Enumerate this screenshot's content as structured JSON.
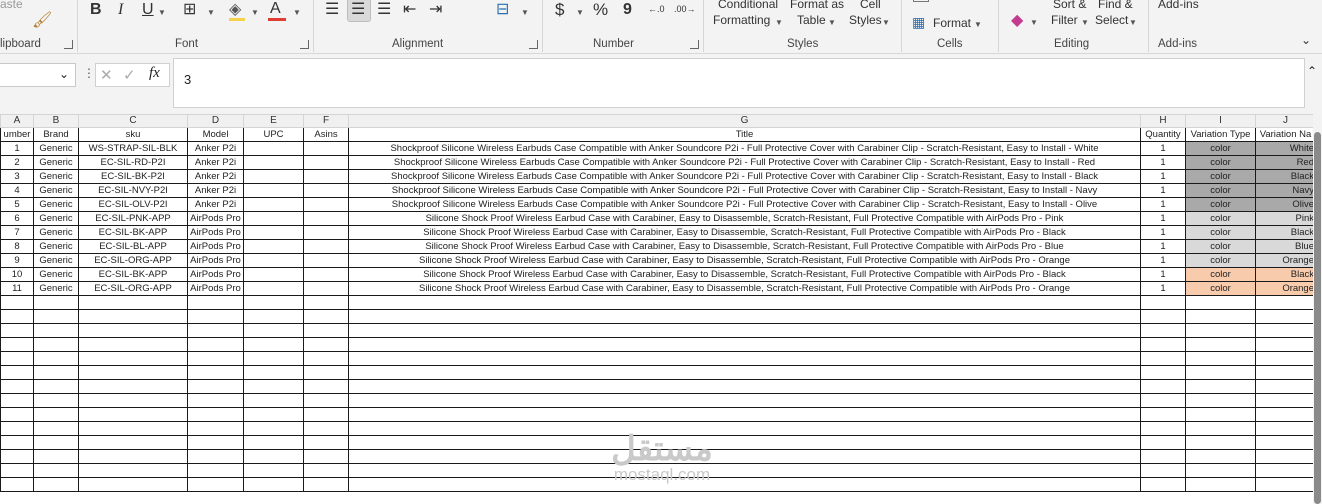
{
  "ribbon": {
    "clipboard": {
      "paste_label": "aste",
      "group_label": "lipboard"
    },
    "font": {
      "group_label": "Font",
      "bold_label": "B",
      "italic_label": "I",
      "underline_label": "U",
      "font_color_label": "A",
      "font_color": "#e03c31"
    },
    "alignment": {
      "group_label": "Alignment"
    },
    "number": {
      "group_label": "Number",
      "currency_label": "$",
      "percent_label": "%",
      "comma_label": "9"
    },
    "styles": {
      "group_label": "Styles",
      "conditional_line1": "Conditional",
      "conditional_line2": "Formatting",
      "format_table_line1": "Format as",
      "format_table_line2": "Table",
      "cell_styles_line1": "Cell",
      "cell_styles_line2": "Styles"
    },
    "cells": {
      "group_label": "Cells",
      "format_label": "Format"
    },
    "editing": {
      "group_label": "Editing",
      "sort_line1": "Sort &",
      "sort_line2": "Filter",
      "find_line1": "Find &",
      "find_line2": "Select"
    },
    "addins": {
      "group_label": "Add-ins",
      "button_label": "Add-ins"
    }
  },
  "formula_bar": {
    "fx_label": "fx",
    "value": "3"
  },
  "columns": [
    {
      "letter": "A",
      "header": "umber"
    },
    {
      "letter": "B",
      "header": "Brand"
    },
    {
      "letter": "C",
      "header": "sku"
    },
    {
      "letter": "D",
      "header": "Model"
    },
    {
      "letter": "E",
      "header": "UPC"
    },
    {
      "letter": "F",
      "header": "Asins"
    },
    {
      "letter": "G",
      "header": "Title"
    },
    {
      "letter": "H",
      "header": "Quantity"
    },
    {
      "letter": "I",
      "header": "Variation Type"
    },
    {
      "letter": "J",
      "header": "Variation Na"
    }
  ],
  "rows": [
    {
      "number": "1",
      "brand": "Generic",
      "sku": "WS-STRAP-SIL-BLK",
      "model": "Anker P2i",
      "upc": "",
      "asins": "",
      "title": "Shockproof Silicone Wireless Earbuds Case Compatible with Anker Soundcore P2i - Full Protective Cover with Carabiner Clip - Scratch-Resistant, Easy to Install - White",
      "quantity": "1",
      "variation_type": "color",
      "variation_name": "White",
      "fill": "gray"
    },
    {
      "number": "2",
      "brand": "Generic",
      "sku": "EC-SIL-RD-P2I",
      "model": "Anker P2i",
      "upc": "",
      "asins": "",
      "title": "Shockproof Silicone Wireless Earbuds Case Compatible with Anker Soundcore P2i - Full Protective Cover with Carabiner Clip - Scratch-Resistant, Easy to Install - Red",
      "quantity": "1",
      "variation_type": "color",
      "variation_name": "Red",
      "fill": "gray"
    },
    {
      "number": "3",
      "brand": "Generic",
      "sku": "EC-SIL-BK-P2I",
      "model": "Anker P2i",
      "upc": "",
      "asins": "",
      "title": "Shockproof Silicone Wireless Earbuds Case Compatible with Anker Soundcore P2i - Full Protective Cover with Carabiner Clip - Scratch-Resistant, Easy to Install - Black",
      "quantity": "1",
      "variation_type": "color",
      "variation_name": "Black",
      "fill": "gray"
    },
    {
      "number": "4",
      "brand": "Generic",
      "sku": "EC-SIL-NVY-P2I",
      "model": "Anker P2i",
      "upc": "",
      "asins": "",
      "title": "Shockproof Silicone Wireless Earbuds Case Compatible with Anker Soundcore P2i - Full Protective Cover with Carabiner Clip - Scratch-Resistant, Easy to Install - Navy",
      "quantity": "1",
      "variation_type": "color",
      "variation_name": "Navy",
      "fill": "gray"
    },
    {
      "number": "5",
      "brand": "Generic",
      "sku": "EC-SIL-OLV-P2I",
      "model": "Anker P2i",
      "upc": "",
      "asins": "",
      "title": "Shockproof Silicone Wireless Earbuds Case Compatible with Anker Soundcore P2i - Full Protective Cover with Carabiner Clip - Scratch-Resistant, Easy to Install - Olive",
      "quantity": "1",
      "variation_type": "color",
      "variation_name": "Olive",
      "fill": "gray"
    },
    {
      "number": "6",
      "brand": "Generic",
      "sku": "EC-SIL-PNK-APP",
      "model": "AirPods Pro",
      "upc": "",
      "asins": "",
      "title": "Silicone Shock Proof Wireless Earbud Case with Carabiner, Easy to Disassemble, Scratch-Resistant, Full Protective Compatible with AirPods Pro - Pink",
      "quantity": "1",
      "variation_type": "color",
      "variation_name": "Pink",
      "fill": "light"
    },
    {
      "number": "7",
      "brand": "Generic",
      "sku": "EC-SIL-BK-APP",
      "model": "AirPods Pro",
      "upc": "",
      "asins": "",
      "title": "Silicone Shock Proof Wireless Earbud Case with Carabiner, Easy to Disassemble, Scratch-Resistant, Full Protective Compatible with AirPods Pro - Black",
      "quantity": "1",
      "variation_type": "color",
      "variation_name": "Black",
      "fill": "light"
    },
    {
      "number": "8",
      "brand": "Generic",
      "sku": "EC-SIL-BL-APP",
      "model": "AirPods Pro",
      "upc": "",
      "asins": "",
      "title": "Silicone Shock Proof Wireless Earbud Case with Carabiner, Easy to Disassemble, Scratch-Resistant, Full Protective Compatible with AirPods Pro - Blue",
      "quantity": "1",
      "variation_type": "color",
      "variation_name": "Blue",
      "fill": "light"
    },
    {
      "number": "9",
      "brand": "Generic",
      "sku": "EC-SIL-ORG-APP",
      "model": "AirPods Pro",
      "upc": "",
      "asins": "",
      "title": "Silicone Shock Proof Wireless Earbud Case with Carabiner, Easy to Disassemble, Scratch-Resistant, Full Protective Compatible with AirPods Pro - Orange",
      "quantity": "1",
      "variation_type": "color",
      "variation_name": "Orange",
      "fill": "light"
    },
    {
      "number": "10",
      "brand": "Generic",
      "sku": "EC-SIL-BK-APP",
      "model": "AirPods Pro",
      "upc": "",
      "asins": "",
      "title": "Silicone Shock Proof Wireless Earbud Case with Carabiner, Easy to Disassemble, Scratch-Resistant, Full Protective Compatible with AirPods Pro - Black",
      "quantity": "1",
      "variation_type": "color",
      "variation_name": "Black",
      "fill": "peach"
    },
    {
      "number": "11",
      "brand": "Generic",
      "sku": "EC-SIL-ORG-APP",
      "model": "AirPods Pro",
      "upc": "",
      "asins": "",
      "title": "Silicone Shock Proof Wireless Earbud Case with Carabiner, Easy to Disassemble, Scratch-Resistant, Full Protective Compatible with AirPods Pro - Orange",
      "quantity": "1",
      "variation_type": "color",
      "variation_name": "Orange",
      "fill": "peach"
    }
  ],
  "colors": {
    "gray": "#a9a9a9",
    "light": "#d9d9d9",
    "peach": "#f8cbad"
  },
  "watermark": {
    "arabic": "مستقل",
    "latin": "mostaql.com"
  }
}
